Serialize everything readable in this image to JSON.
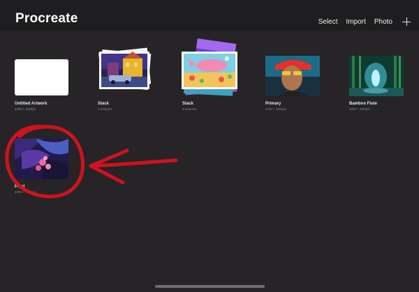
{
  "header": {
    "app_title": "Procreate",
    "actions": {
      "select": "Select",
      "import": "Import",
      "photo": "Photo"
    },
    "new_icon": "plus-icon"
  },
  "gallery": {
    "items": [
      {
        "title": "Untitled Artwork",
        "subtitle": "2388 × 1668px"
      },
      {
        "title": "Stack",
        "subtitle": "3 artworks"
      },
      {
        "title": "Stack",
        "subtitle": "5 artworks"
      },
      {
        "title": "Primary",
        "subtitle": "2121 × 1091px"
      },
      {
        "title": "Bamboo Flute",
        "subtitle": "4000 × 3000px"
      },
      {
        "title": "Petal",
        "subtitle": "4000 × 3000px"
      }
    ]
  },
  "colors": {
    "background": "#262426",
    "topbar": "#1e1d1f",
    "annotation": "#d0121e"
  }
}
